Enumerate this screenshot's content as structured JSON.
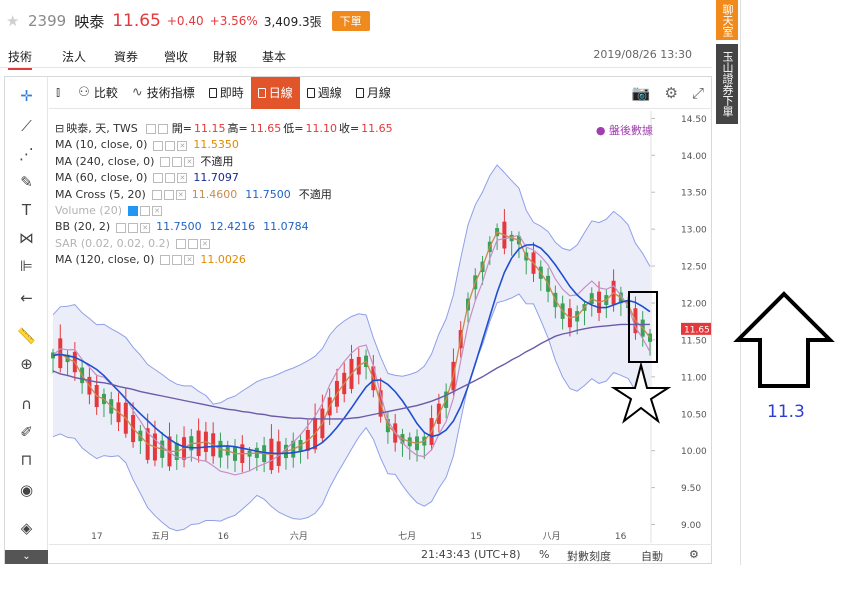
{
  "quote": {
    "code": "2399",
    "name": "映泰",
    "price": "11.65",
    "change": "+0.40",
    "change_pct": "+3.56%",
    "volume": "3,409.3張",
    "order_label": "下單"
  },
  "tabs": [
    {
      "label": "技術"
    },
    {
      "label": "法人"
    },
    {
      "label": "資券"
    },
    {
      "label": "營收"
    },
    {
      "label": "財報"
    },
    {
      "label": "基本"
    }
  ],
  "datetime": "2019/08/26 13:30",
  "side_tags": {
    "chat": "聊天室",
    "broker": "玉山證券下單"
  },
  "toolbar": {
    "compare": "比較",
    "indicators": "技術指標",
    "intraday": "即時",
    "daily": "日線",
    "weekly": "週線",
    "monthly": "月線"
  },
  "legend": {
    "symbol": "映泰, 天, TWS",
    "open_label": "開=",
    "open": "11.15",
    "high_label": "高=",
    "high": "11.65",
    "low_label": "低=",
    "low": "11.10",
    "close_label": "收=",
    "close": "11.65",
    "ma10_label": "MA (10, close, 0)",
    "ma10": "11.5350",
    "ma240_label": "MA (240, close, 0)",
    "ma240": "不適用",
    "ma60_label": "MA (60, close, 0)",
    "ma60": "11.7097",
    "macross_label": "MA Cross (5, 20)",
    "macross_a": "11.4600",
    "macross_b": "11.7500",
    "macross_c": "不適用",
    "volume_label": "Volume (20)",
    "bb_label": "BB (20, 2)",
    "bb_mid": "11.7500",
    "bb_up": "12.4216",
    "bb_low": "11.0784",
    "sar_label": "SAR (0.02, 0.02, 0.2)",
    "ma120_label": "MA (120, close, 0)",
    "ma120": "11.0026",
    "after_hours": "盤後數據"
  },
  "price_axis": {
    "ticks": [
      "14.50",
      "14.00",
      "13.50",
      "13.00",
      "12.50",
      "12.00",
      "11.50",
      "11.00",
      "10.50",
      "10.00",
      "9.50",
      "9.00"
    ],
    "last_price": "11.65"
  },
  "time_axis": {
    "labels": [
      "17",
      "五月",
      "16",
      "六月",
      "七月",
      "15",
      "八月",
      "16"
    ]
  },
  "bottom_bar": {
    "clock": "21:43:43 (UTC+8)",
    "percent": "%",
    "log": "對數刻度",
    "auto": "自動"
  },
  "annotation": {
    "value": "11.3"
  },
  "chart_data": {
    "type": "line",
    "series": [
      {
        "name": "MA (10, close, 0)",
        "values": [
          11.29,
          11.32,
          11.25,
          11.2,
          11.02,
          10.88,
          10.74,
          10.7,
          10.6,
          10.52,
          10.44,
          10.3,
          10.2,
          10.09,
          10.05,
          10.02,
          9.99,
          9.99,
          10.03,
          10.1,
          10.1,
          10.12,
          10.08,
          10.02,
          10.0,
          9.96,
          9.96,
          9.96,
          9.97,
          9.96,
          9.95,
          9.96,
          9.99,
          10.02,
          10.07,
          10.14,
          10.23,
          10.37,
          10.6,
          10.77,
          10.91,
          11.04,
          11.15,
          11.21,
          10.98,
          10.64,
          10.34,
          10.24,
          10.16,
          10.12,
          10.1,
          10.13,
          10.26,
          10.5,
          10.69,
          11.01,
          11.51,
          11.98,
          12.28,
          12.49,
          12.76,
          12.96,
          12.92,
          12.88,
          12.85,
          12.63,
          12.54,
          12.41,
          12.26,
          12.04,
          11.89,
          11.8,
          11.82,
          11.94,
          12.06,
          12.01,
          12.04,
          12.14,
          12.07,
          11.98,
          11.76,
          11.66,
          11.53
        ]
      },
      {
        "name": "MA (60, close, 0)",
        "values": [
          11.08,
          11.04,
          11.02,
          10.99,
          10.97,
          10.95,
          10.93,
          10.92,
          10.9,
          10.87,
          10.85,
          10.83,
          10.8,
          10.78,
          10.76,
          10.74,
          10.72,
          10.7,
          10.68,
          10.66,
          10.64,
          10.62,
          10.6,
          10.58,
          10.56,
          10.55,
          10.53,
          10.52,
          10.5,
          10.49,
          10.47,
          10.46,
          10.45,
          10.44,
          10.44,
          10.43,
          10.43,
          10.43,
          10.43,
          10.43,
          10.43,
          10.44,
          10.45,
          10.47,
          10.49,
          10.51,
          10.53,
          10.55,
          10.57,
          10.59,
          10.61,
          10.64,
          10.67,
          10.71,
          10.75,
          10.8,
          10.85,
          10.9,
          10.95,
          11.0,
          11.06,
          11.12,
          11.17,
          11.23,
          11.28,
          11.34,
          11.39,
          11.45,
          11.5,
          11.55,
          11.58,
          11.6,
          11.63,
          11.65,
          11.67,
          11.68,
          11.69,
          11.7,
          11.71,
          11.71,
          11.71,
          11.71,
          11.71
        ]
      }
    ],
    "ylim": [
      8.75,
      14.6
    ]
  }
}
